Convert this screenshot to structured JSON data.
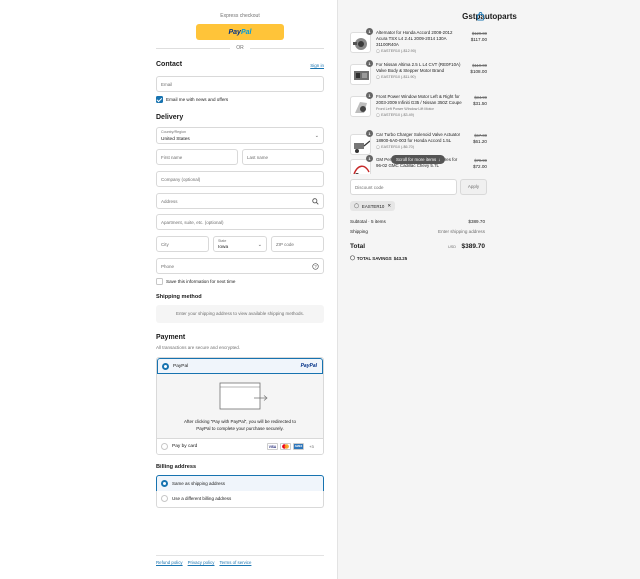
{
  "express": {
    "label": "Express checkout",
    "paypal_brand_a": "Pay",
    "paypal_brand_b": "Pal",
    "or": "OR"
  },
  "contact": {
    "title": "Contact",
    "signin": "Sign in",
    "email_placeholder": "Email",
    "newsletter_label": "Email me with news and offers",
    "newsletter_checked": true
  },
  "delivery": {
    "title": "Delivery",
    "country_label": "Country/Region",
    "country_value": "United States",
    "first_name_placeholder": "First name",
    "last_name_placeholder": "Last name",
    "company_placeholder": "Company (optional)",
    "address_placeholder": "Address",
    "apartment_placeholder": "Apartment, suite, etc. (optional)",
    "city_placeholder": "City",
    "state_label": "State",
    "state_value": "Iowa",
    "zip_placeholder": "ZIP code",
    "phone_placeholder": "Phone",
    "save_info_label": "Save this information for next time",
    "save_info_checked": false
  },
  "shipping_method": {
    "title": "Shipping method",
    "note": "Enter your shipping address to view available shipping methods."
  },
  "payment": {
    "title": "Payment",
    "subtitle": "All transactions are secure and encrypted.",
    "paypal_label": "PayPal",
    "paypal_logo": "PayPal",
    "paypal_info": "After clicking “Pay with PayPal”, you will be redirected to PayPal to complete your purchase securely.",
    "card_label": "Pay by card",
    "card_brands": [
      "VISA",
      "MC",
      "AMEX",
      "+3"
    ],
    "selected": "paypal"
  },
  "billing": {
    "title": "Billing address",
    "same_label": "Same as shipping address",
    "different_label": "Use a different billing address",
    "selected": "same"
  },
  "footer": {
    "links": [
      "Refund policy",
      "Privacy policy",
      "Terms of service"
    ]
  },
  "summary": {
    "store_name": "Gstpautoparts",
    "items": [
      {
        "qty": "1",
        "name": "Alternator for Honda Accord 2008-2012 Acura TSX L4 2.4L 2009-2014 130A 31100R40A",
        "variant": "",
        "discount": "EASTER10 (-$12.90)",
        "old_price": "$129.00",
        "new_price": "$117.00"
      },
      {
        "qty": "1",
        "name": "For Nissan Altima 2.5 L L4 CVT (RE0F10A) Valve Body & Stepper Motor Brand",
        "variant": "",
        "discount": "EASTER10 (-$11.90)",
        "old_price": "$119.00",
        "new_price": "$108.00"
      },
      {
        "qty": "1",
        "name": "Front Power Window Motor Left & Right for 2003-2009 Infiniti G35 / Nissan 350Z Coupe",
        "variant": "Front Left Power Window Lift Motor",
        "discount": "EASTER10 (-$3.49)",
        "old_price": "$34.99",
        "new_price": "$31.50"
      },
      {
        "qty": "1",
        "name": "Car Turbo Charger Solenoid Valve Actuator 18900-6A0-003 for Honda Accord 1.5L",
        "variant": "",
        "discount": "EASTER10 (-$6.70)",
        "old_price": "$67.00",
        "new_price": "$61.20"
      },
      {
        "qty": "1",
        "name": "GM Performance Spark Plugs & Wires for 96-02 GMC Cadillac Chevy 5.7L",
        "variant": "",
        "discount": "",
        "old_price": "$79.99",
        "new_price": "$72.00"
      }
    ],
    "scroll_hint": "Scroll for more items",
    "discount_placeholder": "Discount code",
    "apply_label": "Apply",
    "applied_code": "EASTER10",
    "subtotal_label": "Subtotal · 5 items",
    "subtotal_value": "$389.70",
    "shipping_label": "Shipping",
    "shipping_value": "Enter shipping address",
    "total_label": "Total",
    "currency": "USD",
    "total_value": "$389.70",
    "savings_label": "TOTAL SAVINGS",
    "savings_value": "$43.25"
  },
  "colors": {
    "accent": "#1773b0",
    "paypal_yellow": "#ffc439",
    "summary_bg": "#f5f5f5"
  }
}
